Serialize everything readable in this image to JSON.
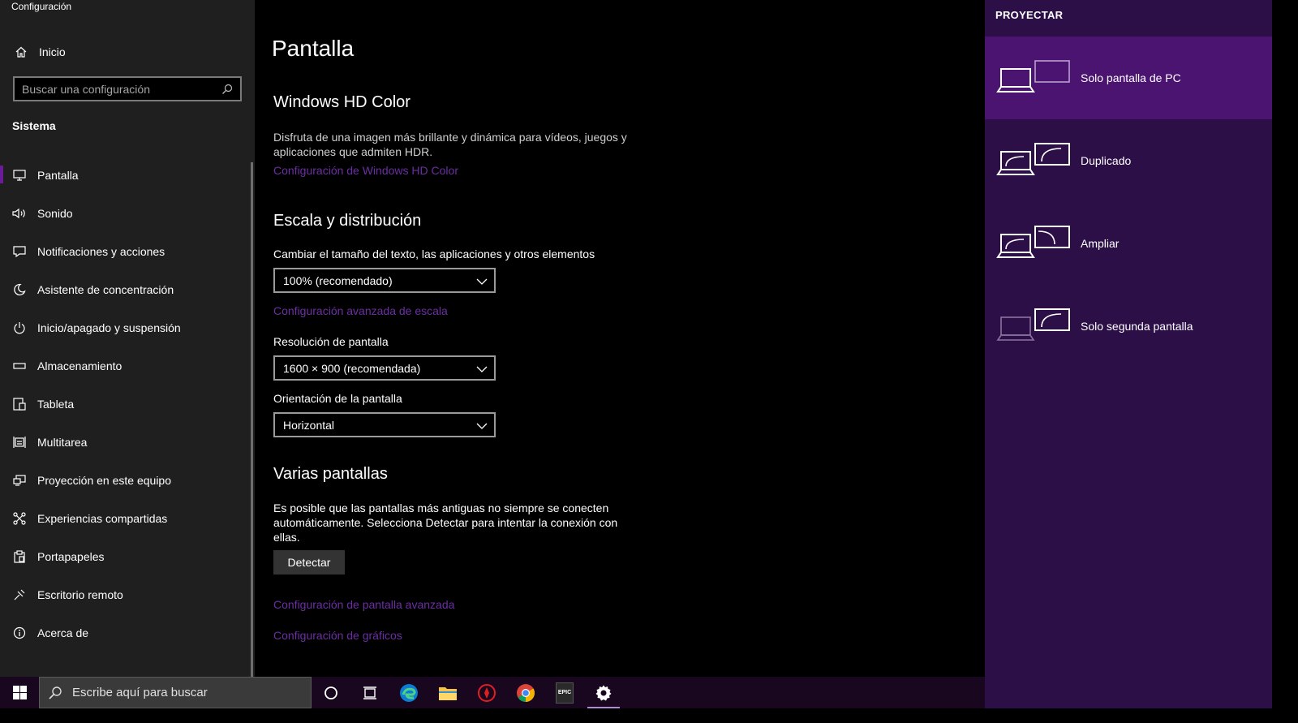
{
  "window": {
    "title": "Configuración"
  },
  "sidebar": {
    "home_label": "Inicio",
    "search_placeholder": "Buscar una configuración",
    "section_label": "Sistema",
    "items": [
      {
        "label": "Pantalla",
        "icon": "monitor-icon",
        "active": true
      },
      {
        "label": "Sonido",
        "icon": "speaker-icon"
      },
      {
        "label": "Notificaciones y acciones",
        "icon": "notification-icon"
      },
      {
        "label": "Asistente de concentración",
        "icon": "moon-icon"
      },
      {
        "label": "Inicio/apagado y suspensión",
        "icon": "power-icon"
      },
      {
        "label": "Almacenamiento",
        "icon": "storage-icon"
      },
      {
        "label": "Tableta",
        "icon": "tablet-icon"
      },
      {
        "label": "Multitarea",
        "icon": "multitask-icon"
      },
      {
        "label": "Proyección en este equipo",
        "icon": "projection-icon"
      },
      {
        "label": "Experiencias compartidas",
        "icon": "shared-icon"
      },
      {
        "label": "Portapapeles",
        "icon": "clipboard-icon"
      },
      {
        "label": "Escritorio remoto",
        "icon": "remote-icon"
      },
      {
        "label": "Acerca de",
        "icon": "info-icon"
      }
    ]
  },
  "main": {
    "title": "Pantalla",
    "hd": {
      "heading": "Windows HD Color",
      "desc": "Disfruta de una imagen más brillante y dinámica para vídeos, juegos y aplicaciones que admiten HDR.",
      "link": "Configuración de Windows HD Color"
    },
    "scale": {
      "heading": "Escala y distribución",
      "text_size_label": "Cambiar el tamaño del texto, las aplicaciones y otros elementos",
      "text_size_value": "100% (recomendado)",
      "advanced_link": "Configuración avanzada de escala",
      "resolution_label": "Resolución de pantalla",
      "resolution_value": "1600 × 900 (recomendada)",
      "orientation_label": "Orientación de la pantalla",
      "orientation_value": "Horizontal"
    },
    "multi": {
      "heading": "Varias pantallas",
      "desc": "Es posible que las pantallas más antiguas no siempre se conecten automáticamente. Selecciona Detectar para intentar la conexión con ellas.",
      "detect_button": "Detectar",
      "advanced_display_link": "Configuración de pantalla avanzada",
      "graphics_link": "Configuración de gráficos"
    }
  },
  "project": {
    "title": "PROYECTAR",
    "options": [
      {
        "label": "Solo pantalla de PC",
        "selected": true
      },
      {
        "label": "Duplicado"
      },
      {
        "label": "Ampliar"
      },
      {
        "label": "Solo segunda pantalla"
      }
    ]
  },
  "taskbar": {
    "search_placeholder": "Escribe aquí para buscar",
    "icons": [
      "windows-start-icon",
      "cortana-icon",
      "task-view-icon",
      "edge-icon",
      "file-explorer-icon",
      "game-icon",
      "chrome-icon",
      "epic-games-icon",
      "settings-icon"
    ],
    "epic_text": "EPIC"
  },
  "colors": {
    "accent": "#6a1b9a",
    "link": "#6b2fa3",
    "project_panel": "#2c0f47",
    "project_selected": "#4a1470"
  }
}
